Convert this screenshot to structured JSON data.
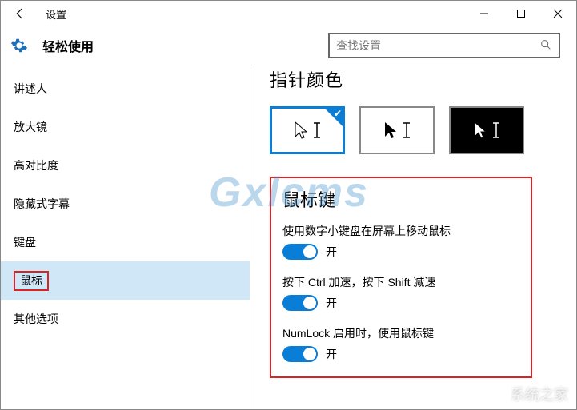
{
  "window": {
    "title": "设置"
  },
  "header": {
    "title": "轻松使用",
    "search_placeholder": "查找设置"
  },
  "sidebar": {
    "items": [
      {
        "label": "讲述人"
      },
      {
        "label": "放大镜"
      },
      {
        "label": "高对比度"
      },
      {
        "label": "隐藏式字幕"
      },
      {
        "label": "键盘"
      },
      {
        "label": "鼠标"
      },
      {
        "label": "其他选项"
      }
    ],
    "selected_index": 5
  },
  "main": {
    "pointer_title": "指针颜色",
    "mouse_keys_title": "鼠标键",
    "settings": [
      {
        "label": "使用数字小键盘在屏幕上移动鼠标",
        "state": "开"
      },
      {
        "label": "按下 Ctrl 加速，按下 Shift 减速",
        "state": "开"
      },
      {
        "label": "NumLock 启用时，使用鼠标键",
        "state": "开"
      }
    ]
  },
  "watermark": "Gxlcms",
  "footer_mark": "系统之家"
}
